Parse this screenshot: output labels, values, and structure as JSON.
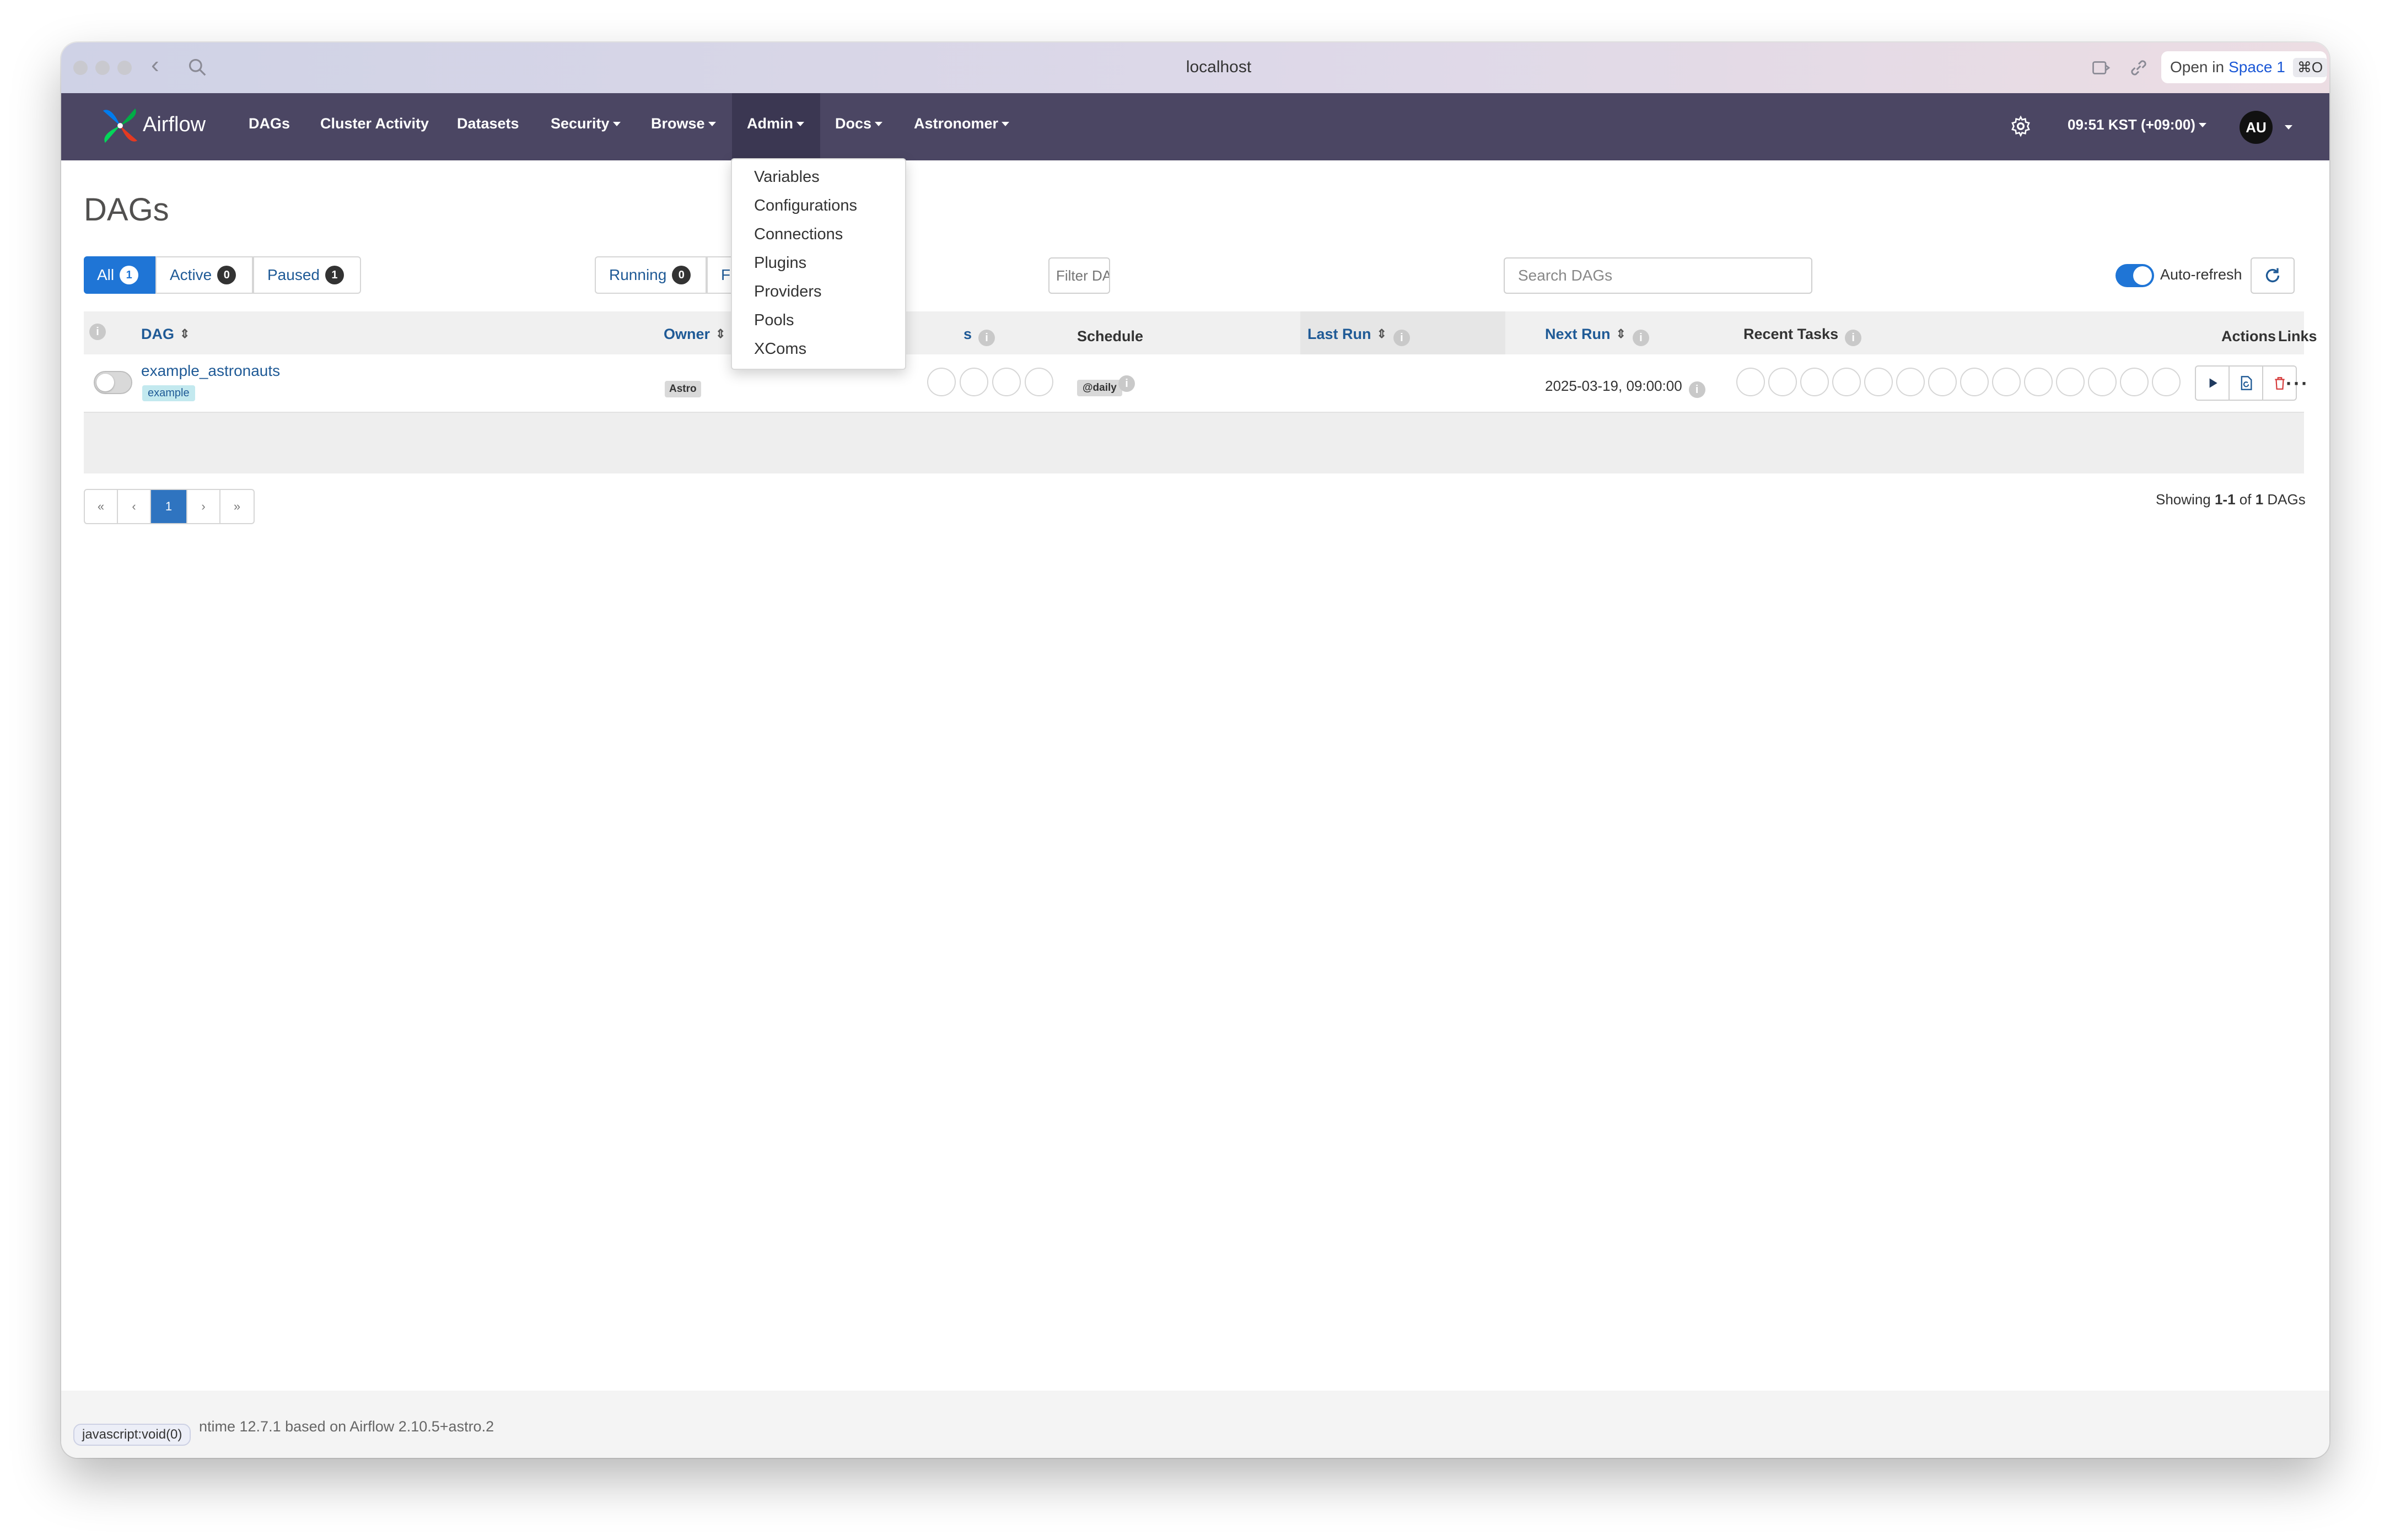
{
  "browser": {
    "url": "localhost",
    "open_in_prefix": "Open in",
    "open_in_space": "Space 1",
    "open_in_shortcut": "⌘O"
  },
  "navbar": {
    "brand": "Airflow",
    "items": [
      "DAGs",
      "Cluster Activity",
      "Datasets",
      "Security",
      "Browse",
      "Admin",
      "Docs",
      "Astronomer"
    ],
    "time": "09:51 KST (+09:00)",
    "avatar_initials": "AU"
  },
  "admin_menu": {
    "items": [
      "Variables",
      "Configurations",
      "Connections",
      "Plugins",
      "Providers",
      "Pools",
      "XComs"
    ]
  },
  "page": {
    "title": "DAGs"
  },
  "filters": {
    "all_label": "All",
    "all_count": "1",
    "active_label": "Active",
    "active_count": "0",
    "paused_label": "Paused",
    "paused_count": "1",
    "running_label": "Running",
    "running_count": "0",
    "failed_label": "F",
    "filter_placeholder": "Filter DAGs by tag",
    "search_placeholder": "Search DAGs",
    "autorefresh_label": "Auto-refresh"
  },
  "table": {
    "headers": {
      "dag": "DAG",
      "owner": "Owner",
      "runs": "s",
      "schedule": "Schedule",
      "last_run": "Last Run",
      "next_run": "Next Run",
      "recent_tasks": "Recent Tasks",
      "actions": "Actions",
      "links": "Links"
    },
    "rows": [
      {
        "dag_id": "example_astronauts",
        "tag": "example",
        "owner": "Astro",
        "schedule": "@daily",
        "last_run": "",
        "next_run": "2025-03-19, 09:00:00",
        "links": "···"
      }
    ]
  },
  "pagination": {
    "first": "«",
    "prev": "‹",
    "current": "1",
    "next": "›",
    "last": "»",
    "showing_prefix": "Showing",
    "showing_range": "1-1",
    "showing_of": "of",
    "showing_total": "1",
    "showing_suffix": "DAGs"
  },
  "footer": {
    "text": "ntime 12.7.1 based on Airflow 2.10.5+astro.2",
    "status_tip": "javascript:void(0)"
  },
  "colors": {
    "navbar_bg": "#4b4663",
    "primary": "#1f75d6",
    "link": "#1f5a96",
    "delete": "#d63a3a"
  }
}
